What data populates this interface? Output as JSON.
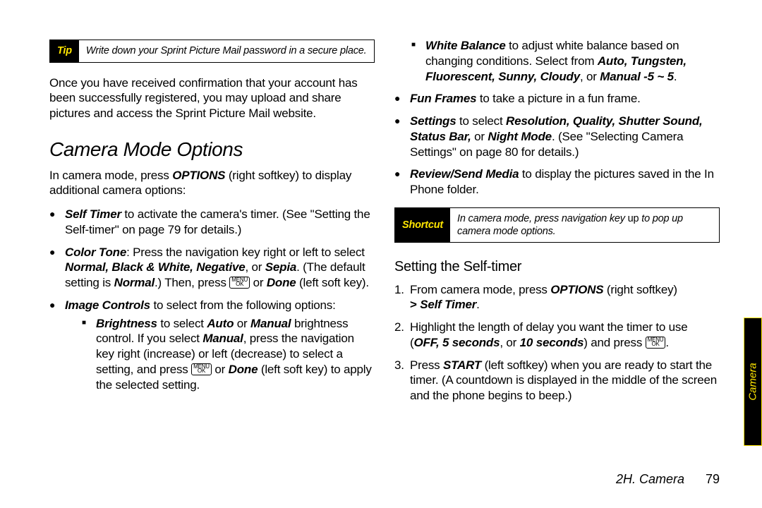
{
  "tip": {
    "tag": "Tip",
    "body": "Write down your Sprint Picture Mail password in a secure place."
  },
  "left": {
    "intro_para": "Once you have received confirmation that your account has been successfully registered, you may upload and share pictures and access the Sprint Picture Mail website.",
    "section_title": "Camera Mode Options",
    "camera_mode_intro_pre": "In camera mode, press ",
    "camera_mode_intro_options": "OPTIONS",
    "camera_mode_intro_post": " (right softkey) to display additional camera options:",
    "self_timer": {
      "label": "Self Timer",
      "rest": " to activate the camera's timer. (See \"Setting the Self-timer\" on page 79 for details.)"
    },
    "color_tone": {
      "label": "Color Tone",
      "p1": ": Press the navigation key right or left to select ",
      "options": "Normal, Black & White, Negative",
      "p2": ", or ",
      "sepia": "Sepia",
      "p3": ". (The default setting is ",
      "normal": "Normal",
      "p4": ".) Then, press ",
      "or_done": " or ",
      "done": "Done",
      "p5": " (left soft key)."
    },
    "image_controls": {
      "label": "Image Controls",
      "rest": " to select from the following options:"
    },
    "brightness": {
      "label": "Brightness",
      "p1": " to select ",
      "auto": "Auto",
      "p2": " or ",
      "manual": "Manual",
      "p3": " brightness control. If you select ",
      "manual2": "Manual",
      "p4": ", press the navigation key right (increase) or left (decrease) to select a setting, and press ",
      "or_done": " or ",
      "done": "Done",
      "p5": " (left soft key) to apply the selected setting."
    }
  },
  "right": {
    "white_balance": {
      "label": "White Balance",
      "p1": " to adjust white balance based on changing conditions. Select from ",
      "opts": "Auto, Tungsten, Fluorescent, Sunny, Cloudy",
      "p2": ", or ",
      "manual": "Manual -5 ~ 5",
      "p3": "."
    },
    "fun_frames": {
      "label": "Fun Frames",
      "rest": " to take a picture in a fun frame."
    },
    "settings": {
      "label": "Settings",
      "p1": " to select ",
      "opts": "Resolution, Quality, Shutter Sound, Status Bar,",
      "p2": " or ",
      "night": "Night Mode",
      "p3": ". (See \"Selecting Camera Settings\" on page 80 for details.)"
    },
    "review": {
      "label": "Review/Send Media",
      "rest": " to display the pictures saved in the In Phone folder."
    },
    "shortcut": {
      "tag": "Shortcut",
      "pre": "In camera mode, press navigation key ",
      "up": "up",
      "post": " to pop up camera mode options."
    },
    "sub_title": "Setting the Self-timer",
    "step1": {
      "p1": "From camera mode, press ",
      "options": "OPTIONS",
      "p2": " (right softkey) ",
      "gt": ">",
      "self_timer": "Self Timer",
      "p3": "."
    },
    "step2": {
      "p1": "Highlight the length of delay you want the timer to use (",
      "opts": "OFF, 5 seconds",
      "p2": ", or ",
      "ten": "10 seconds",
      "p3": ") and press ",
      "p4": "."
    },
    "step3": {
      "p1": "Press ",
      "start": "START",
      "p2": " (left softkey) when you are ready to start the timer. (A countdown is displayed in the middle of the screen and the phone begins to beep.)"
    }
  },
  "key": {
    "menu": "MENU",
    "ok": "OK"
  },
  "sidetab": "Camera",
  "footer": {
    "chapter": "2H. Camera",
    "page": "79"
  }
}
